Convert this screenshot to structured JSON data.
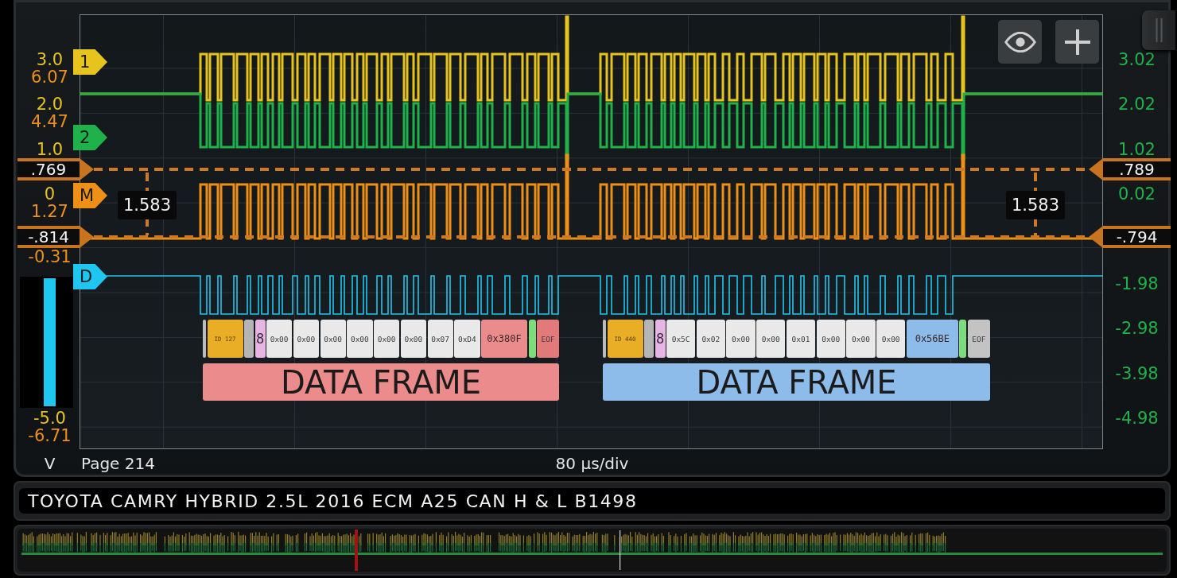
{
  "channels": [
    {
      "label": "1",
      "color": "#e6c31d"
    },
    {
      "label": "2",
      "color": "#1fb24a"
    },
    {
      "label": "M",
      "color": "#ee8f17"
    },
    {
      "label": "D",
      "color": "#1ec6f0"
    }
  ],
  "left_axis": {
    "rows": [
      {
        "ch1": "3.0",
        "math": "6.07"
      },
      {
        "ch1": "2.0",
        "math": "4.47"
      },
      {
        "ch1": "1.0"
      },
      {
        "ch1": "0",
        "math": "1.27"
      },
      {
        "math": "-0.31"
      },
      {
        "ch1": "-5.0",
        "math": "-6.71"
      }
    ],
    "unit": "V"
  },
  "right_axis": {
    "ticks": [
      "3.02",
      "2.02",
      "1.02",
      "0.02",
      "-1.98",
      "-2.98",
      "-3.98",
      "-4.98"
    ]
  },
  "cursors": [
    {
      "left": ".769",
      "right": ".789"
    },
    {
      "left": "-.814",
      "right": "-.794"
    }
  ],
  "cursor_deltas": [
    "1.583",
    "1.583"
  ],
  "frames": [
    {
      "banner": "DATA FRAME",
      "color": "#ec8b8b",
      "error": true,
      "cells": [
        {
          "kind": "sof"
        },
        {
          "kind": "id",
          "text": "ID 127"
        },
        {
          "kind": "control"
        },
        {
          "kind": "dlc",
          "text": "8"
        },
        {
          "kind": "data",
          "text": "0x00"
        },
        {
          "kind": "data",
          "text": "0x00"
        },
        {
          "kind": "data",
          "text": "0x00"
        },
        {
          "kind": "data",
          "text": "0x00"
        },
        {
          "kind": "data",
          "text": "0x00"
        },
        {
          "kind": "data",
          "text": "0x00"
        },
        {
          "kind": "data",
          "text": "0x07"
        },
        {
          "kind": "data",
          "text": "0xD4"
        },
        {
          "kind": "crc",
          "text": "0x380F"
        },
        {
          "kind": "ack"
        },
        {
          "kind": "eof",
          "text": "EOF"
        }
      ]
    },
    {
      "banner": "DATA FRAME",
      "color": "#8dbbea",
      "error": false,
      "cells": [
        {
          "kind": "sof"
        },
        {
          "kind": "id",
          "text": "ID 440"
        },
        {
          "kind": "control"
        },
        {
          "kind": "dlc",
          "text": "8"
        },
        {
          "kind": "data",
          "text": "0x5C"
        },
        {
          "kind": "data",
          "text": "0x02"
        },
        {
          "kind": "data",
          "text": "0x00"
        },
        {
          "kind": "data",
          "text": "0x00"
        },
        {
          "kind": "data",
          "text": "0x01"
        },
        {
          "kind": "data",
          "text": "0x00"
        },
        {
          "kind": "data",
          "text": "0x00"
        },
        {
          "kind": "data",
          "text": "0x00"
        },
        {
          "kind": "crc",
          "text": "0x56BE"
        },
        {
          "kind": "ack"
        },
        {
          "kind": "eof",
          "text": "EOF"
        }
      ]
    }
  ],
  "footer": {
    "page": "Page 214",
    "timebase": "80 µs/div"
  },
  "title": "TOYOTA CAMRY HYBRID 2.5L 2016 ECM A25 CAN H & L B1498"
}
